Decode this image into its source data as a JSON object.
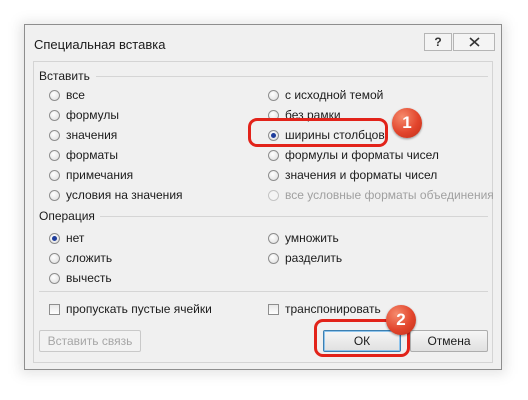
{
  "dialog": {
    "title": "Специальная вставка",
    "help_label": "?"
  },
  "paste": {
    "label": "Вставить",
    "options_left": [
      "все",
      "формулы",
      "значения",
      "форматы",
      "примечания",
      "условия на значения"
    ],
    "options_right": [
      "с исходной темой",
      "без рамки",
      "ширины столбцов",
      "формулы и форматы чисел",
      "значения и форматы чисел",
      "все условные форматы объединения"
    ],
    "selected": "ширины столбцов"
  },
  "operation": {
    "label": "Операция",
    "options_left": [
      "нет",
      "сложить",
      "вычесть"
    ],
    "options_right": [
      "умножить",
      "разделить"
    ],
    "selected": "нет"
  },
  "checkboxes": {
    "skip_blanks": "пропускать пустые ячейки",
    "transpose": "транспонировать"
  },
  "buttons": {
    "paste_link": "Вставить связь",
    "ok": "ОК",
    "cancel": "Отмена"
  },
  "annotations": {
    "marker_1": "1",
    "marker_2": "2",
    "color": "#e2231a"
  }
}
